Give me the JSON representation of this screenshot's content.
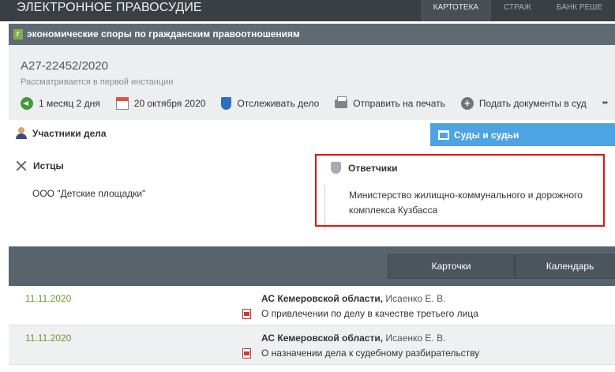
{
  "topbar": {
    "brand": "ЭЛЕКТРОННОЕ ПРАВОСУДИЕ",
    "nav": [
      {
        "label": "КАРТОТЕКА",
        "active": true
      },
      {
        "label": "СТРАЖ",
        "active": false
      },
      {
        "label": "БАНК РЕШЕ",
        "active": false
      }
    ]
  },
  "category": {
    "badge": "г",
    "label": "экономические споры по гражданским правоотношениям"
  },
  "case": {
    "number": "А27-22452/2020",
    "status": "Рассматривается в первой инстанции",
    "actions": {
      "duration": "1 месяц 2 дня",
      "date": "20 октября 2020",
      "track": "Отслеживать дело",
      "print": "Отправить на печать",
      "submit": "Подать документы в суд",
      "more": "••"
    }
  },
  "tabs": {
    "participants": "Участники дела",
    "courts": "Суды и судьи"
  },
  "parties": {
    "plaintiffs_label": "Истцы",
    "plaintiffs": [
      "ООО \"Детские площадки\""
    ],
    "defendants_label": "Ответчики",
    "defendants": [
      "Министерство жилищно-коммунального и дорожного комплекса Кузбасса"
    ]
  },
  "toolbar": {
    "cards": "Карточки",
    "calendar": "Календарь"
  },
  "events": [
    {
      "date": "11.11.2020",
      "court": "АС Кемеровской области,",
      "judge": "Исаенко Е. В.",
      "document": "О привлечении по делу в качестве третьего лица"
    },
    {
      "date": "11.11.2020",
      "court": "АС Кемеровской области,",
      "judge": "Исаенко Е. В.",
      "document": "О назначении дела к судебному разбирательству"
    }
  ],
  "colors": {
    "topbar": "#3a3f44",
    "category_bar": "#5f6a73",
    "courts_tab": "#4ea3e3",
    "highlight_border": "#e01616",
    "event_date": "#6a9a2e"
  }
}
